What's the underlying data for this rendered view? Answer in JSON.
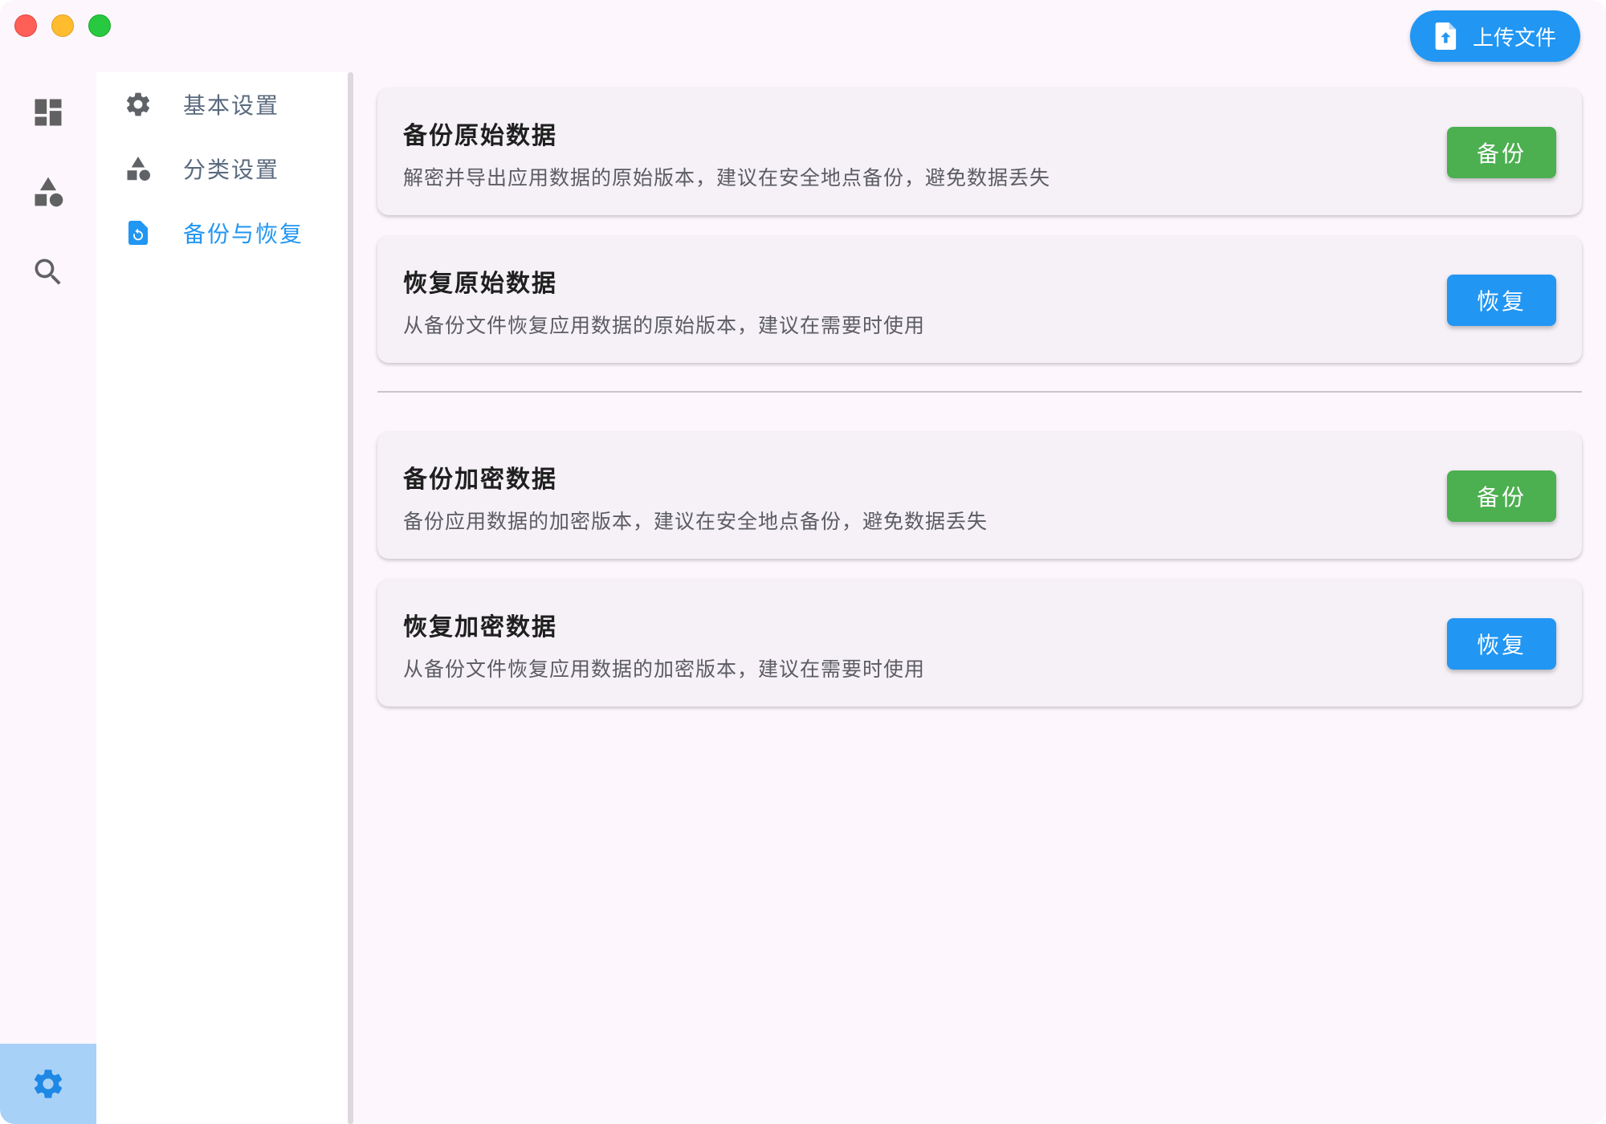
{
  "toolbar": {
    "upload_label": "上传文件",
    "upload_icon": "file-upload-icon"
  },
  "rail": {
    "items": [
      {
        "name": "dashboard",
        "icon": "dashboard-icon"
      },
      {
        "name": "category",
        "icon": "category-icon"
      },
      {
        "name": "search",
        "icon": "search-icon"
      }
    ],
    "settings": {
      "icon": "gear-icon",
      "active": true,
      "highlight_color": "#a8d1f7"
    }
  },
  "subnav": {
    "items": [
      {
        "label": "基本设置",
        "icon": "gear-icon",
        "active": false
      },
      {
        "label": "分类设置",
        "icon": "category-icon",
        "active": false
      },
      {
        "label": "备份与恢复",
        "icon": "backup-restore-icon",
        "active": true
      }
    ]
  },
  "cards": [
    {
      "title": "备份原始数据",
      "description": "解密并导出应用数据的原始版本，建议在安全地点备份，避免数据丢失",
      "button": "备份",
      "button_color": "#4caf50"
    },
    {
      "title": "恢复原始数据",
      "description": "从备份文件恢复应用数据的原始版本，建议在需要时使用",
      "button": "恢复",
      "button_color": "#2196f3"
    },
    {
      "title": "备份加密数据",
      "description": "备份应用数据的加密版本，建议在安全地点备份，避免数据丢失",
      "button": "备份",
      "button_color": "#4caf50"
    },
    {
      "title": "恢复加密数据",
      "description": "从备份文件恢复应用数据的加密版本，建议在需要时使用",
      "button": "恢复",
      "button_color": "#2196f3"
    }
  ],
  "colors": {
    "accent": "#2196f3",
    "success": "#4caf50",
    "background": "#fdf7fd"
  }
}
